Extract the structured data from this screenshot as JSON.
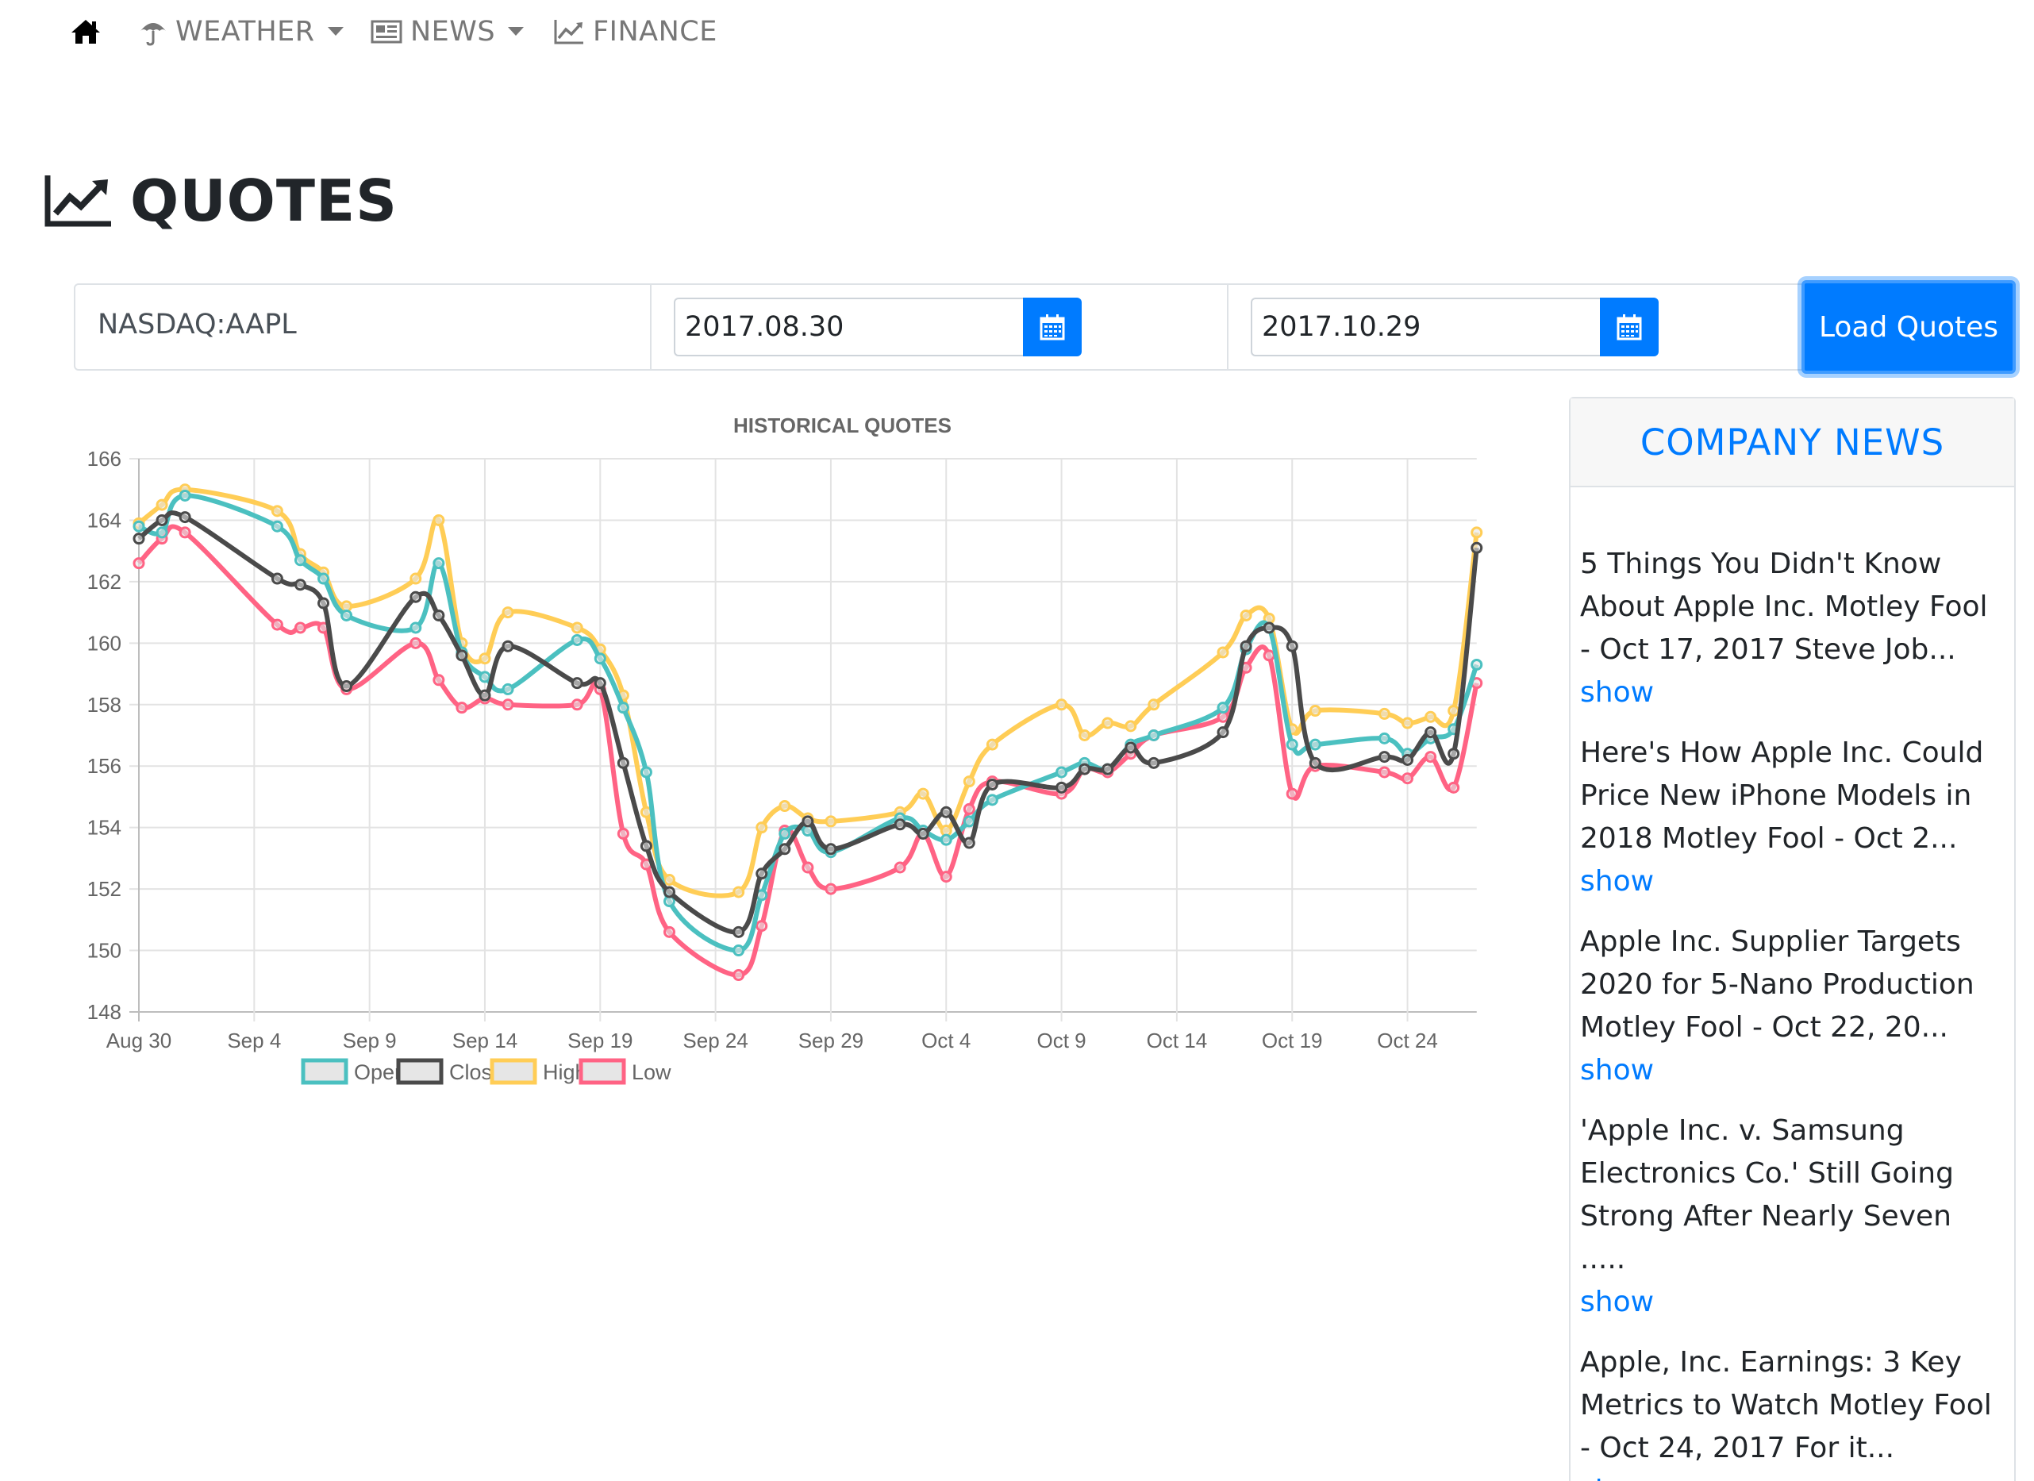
{
  "nav": {
    "items": [
      {
        "label": "WEATHER"
      },
      {
        "label": "NEWS"
      },
      {
        "label": "FINANCE"
      }
    ]
  },
  "page": {
    "title": "QUOTES"
  },
  "form": {
    "symbol": "NASDAQ:AAPL",
    "from_date": "2017.08.30",
    "to_date": "2017.10.29",
    "load_label": "Load Quotes"
  },
  "news": {
    "header": "COMPANY NEWS",
    "items": [
      {
        "text": "5 Things You Didn't Know About Apple Inc. Motley Fool - Oct 17, 2017 Steve Job...",
        "link": "show"
      },
      {
        "text": "Here's How Apple Inc. Could Price New iPhone Models in 2018 Motley Fool - Oct 2...",
        "link": "show"
      },
      {
        "text": "Apple Inc. Supplier Targets 2020 for 5-Nano Production Motley Fool - Oct 22, 20...",
        "link": "show"
      },
      {
        "text": "'Apple Inc. v. Samsung Electronics Co.' Still Going Strong After Nearly Seven .....",
        "link": "show"
      },
      {
        "text": "Apple, Inc. Earnings: 3 Key Metrics to Watch Motley Fool - Oct 24, 2017 For it...",
        "link": "show"
      }
    ]
  },
  "colors": {
    "open": "#4bc0c0",
    "close": "#4a4a4a",
    "high": "#ffcd56",
    "low": "#ff6384",
    "accent": "#007bff"
  },
  "chart_data": {
    "type": "line",
    "title": "HISTORICAL QUOTES",
    "x_tick_labels": [
      "Aug 30",
      "Sep 4",
      "Sep 9",
      "Sep 14",
      "Sep 19",
      "Sep 24",
      "Sep 29",
      "Oct 4",
      "Oct 9",
      "Oct 14",
      "Oct 19",
      "Oct 24"
    ],
    "ylim": [
      148,
      166
    ],
    "y_ticks": [
      148,
      150,
      152,
      154,
      156,
      158,
      160,
      162,
      164,
      166
    ],
    "grid": true,
    "legend_position": "bottom",
    "x": [
      "2017-08-30",
      "2017-08-31",
      "2017-09-01",
      "2017-09-05",
      "2017-09-06",
      "2017-09-07",
      "2017-09-08",
      "2017-09-11",
      "2017-09-12",
      "2017-09-13",
      "2017-09-14",
      "2017-09-15",
      "2017-09-18",
      "2017-09-19",
      "2017-09-20",
      "2017-09-21",
      "2017-09-22",
      "2017-09-25",
      "2017-09-26",
      "2017-09-27",
      "2017-09-28",
      "2017-09-29",
      "2017-10-02",
      "2017-10-03",
      "2017-10-04",
      "2017-10-05",
      "2017-10-06",
      "2017-10-09",
      "2017-10-10",
      "2017-10-11",
      "2017-10-12",
      "2017-10-13",
      "2017-10-16",
      "2017-10-17",
      "2017-10-18",
      "2017-10-19",
      "2017-10-20",
      "2017-10-23",
      "2017-10-24",
      "2017-10-25",
      "2017-10-26",
      "2017-10-27"
    ],
    "series": [
      {
        "name": "Open",
        "color": "#4bc0c0",
        "values": [
          163.8,
          163.6,
          164.8,
          163.8,
          162.7,
          162.1,
          160.9,
          160.5,
          162.6,
          159.7,
          158.9,
          158.5,
          160.1,
          159.5,
          157.9,
          155.8,
          151.6,
          150.0,
          151.8,
          153.8,
          153.9,
          153.2,
          154.3,
          153.9,
          153.6,
          154.2,
          154.9,
          155.8,
          156.1,
          155.9,
          156.7,
          157.0,
          157.9,
          159.8,
          160.5,
          156.7,
          156.7,
          156.9,
          156.4,
          156.9,
          157.2,
          159.3
        ]
      },
      {
        "name": "Close",
        "color": "#4a4a4a",
        "values": [
          163.4,
          164.0,
          164.1,
          162.1,
          161.9,
          161.3,
          158.6,
          161.5,
          160.9,
          159.6,
          158.3,
          159.9,
          158.7,
          158.7,
          156.1,
          153.4,
          151.9,
          150.6,
          152.5,
          153.3,
          154.2,
          153.3,
          154.1,
          153.8,
          154.5,
          153.5,
          155.4,
          155.3,
          155.9,
          155.9,
          156.6,
          156.1,
          157.1,
          159.9,
          160.5,
          159.9,
          156.1,
          156.3,
          156.2,
          157.1,
          156.4,
          163.1
        ]
      },
      {
        "name": "High",
        "color": "#ffcd56",
        "values": [
          163.9,
          164.5,
          165.0,
          164.3,
          162.9,
          162.3,
          161.2,
          162.1,
          164.0,
          160.0,
          159.5,
          161.0,
          160.5,
          159.8,
          158.3,
          154.5,
          152.3,
          151.9,
          154.0,
          154.7,
          154.3,
          154.2,
          154.5,
          155.1,
          153.9,
          155.5,
          156.7,
          158.0,
          157.0,
          157.4,
          157.3,
          158.0,
          159.7,
          160.9,
          160.8,
          157.2,
          157.8,
          157.7,
          157.4,
          157.6,
          157.8,
          163.6
        ]
      },
      {
        "name": "Low",
        "color": "#ff6384",
        "values": [
          162.6,
          163.4,
          163.6,
          160.6,
          160.5,
          160.5,
          158.5,
          160.0,
          158.8,
          157.9,
          158.2,
          158.0,
          158.0,
          158.5,
          153.8,
          152.8,
          150.6,
          149.2,
          150.8,
          153.9,
          152.7,
          152.0,
          152.7,
          153.8,
          152.4,
          154.6,
          155.5,
          155.1,
          155.9,
          155.8,
          156.4,
          157.0,
          157.6,
          159.2,
          159.6,
          155.1,
          156.0,
          155.8,
          155.6,
          156.3,
          155.3,
          158.7
        ]
      }
    ]
  }
}
